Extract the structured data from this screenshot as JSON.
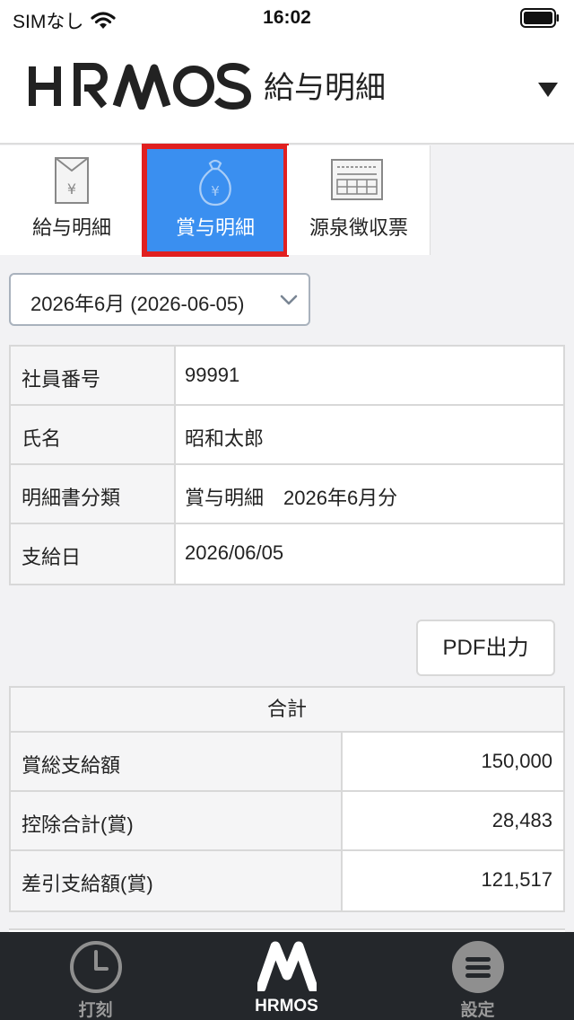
{
  "status_bar": {
    "carrier": "SIMなし",
    "time": "16:02"
  },
  "header": {
    "logo_text": "HRMOS",
    "subtitle": "給与明細",
    "menu_icon": "caret-down-icon"
  },
  "tabs": [
    {
      "label": "給与明細",
      "icon": "envelope-yen-icon",
      "active": false
    },
    {
      "label": "賞与明細",
      "icon": "money-bag-yen-icon",
      "active": true
    },
    {
      "label": "源泉徴収票",
      "icon": "form-sheet-icon",
      "active": false
    }
  ],
  "period_select": {
    "value": "2026年6月 (2026-06-05)"
  },
  "info": {
    "rows": [
      {
        "key": "社員番号",
        "value": "99991"
      },
      {
        "key": "氏名",
        "value": "昭和太郎"
      },
      {
        "key": "明細書分類",
        "value": "賞与明細　2026年6月分"
      },
      {
        "key": "支給日",
        "value": "2026/06/05"
      }
    ]
  },
  "pdf_button": {
    "label": "PDF出力"
  },
  "totals": {
    "header": "合計",
    "rows": [
      {
        "key": "賞総支給額",
        "value": "150,000"
      },
      {
        "key": "控除合計(賞)",
        "value": "28,483"
      },
      {
        "key": "差引支給額(賞)",
        "value": "121,517"
      }
    ]
  },
  "bottom_nav": [
    {
      "label": "打刻",
      "icon": "clock-icon",
      "active": false
    },
    {
      "label": "HRMOS",
      "icon": "hrmos-logo-icon",
      "active": true
    },
    {
      "label": "設定",
      "icon": "menu-icon",
      "active": false
    }
  ],
  "colors": {
    "tab_active_bg": "#3a8ff0",
    "highlight_border": "#e02020",
    "nav_bg": "#24272b"
  }
}
